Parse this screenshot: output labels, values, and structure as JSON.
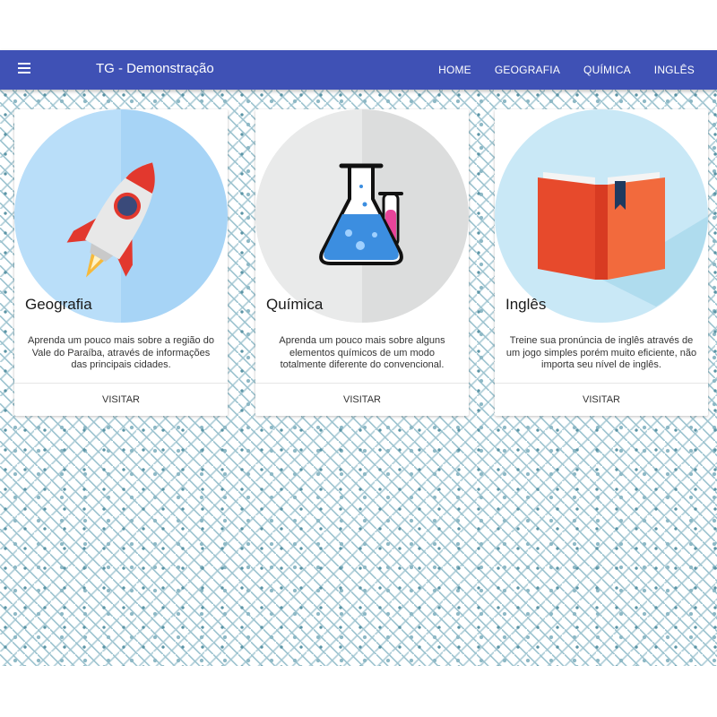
{
  "app": {
    "title": "TG - Demonstração"
  },
  "icons": {
    "menu": "menu-icon"
  },
  "nav": [
    {
      "label": "HOME"
    },
    {
      "label": "GEOGRAFIA"
    },
    {
      "label": "QUÍMICA"
    },
    {
      "label": "INGLÊS"
    }
  ],
  "cards": [
    {
      "title": "Geografia",
      "text": "Aprenda um pouco mais sobre a região do Vale do Paraíba, através de informações das principais cidades.",
      "action": "VISITAR",
      "image_icon": "rocket-icon"
    },
    {
      "title": "Química",
      "text": "Aprenda um pouco mais sobre alguns elementos químicos de um modo totalmente diferente do convencional.",
      "action": "VISITAR",
      "image_icon": "flask-icon"
    },
    {
      "title": "Inglês",
      "text": "Treine sua pronúncia de inglês através de um jogo simples porém muito eficiente, não importa seu nível de inglês.",
      "action": "VISITAR",
      "image_icon": "book-icon"
    }
  ],
  "colors": {
    "appbar": "#3f51b5",
    "rocket_bg": "#a7d4f6",
    "flask_bg": "#dcdddd",
    "book_bg": "#c9e8f6"
  }
}
